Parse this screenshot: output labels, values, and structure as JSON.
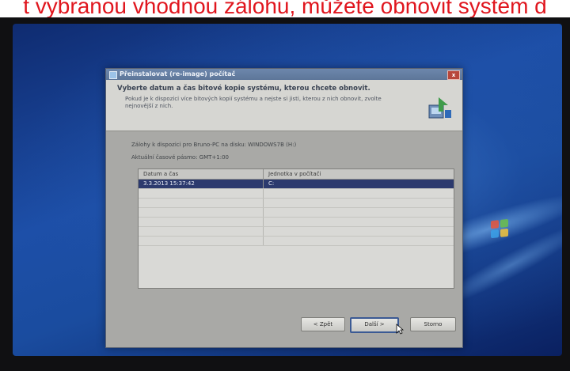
{
  "caption": {
    "text": "t vybranou vhodnou zálohu, můžete obnovit systém d",
    "color": "#e0161e"
  },
  "dialog": {
    "title": "Přeinstalovat (re-image) počítač",
    "close_label": "x",
    "header_title": "Vyberte datum a čas bitové kopie systému, kterou chcete obnovit.",
    "header_description": "Pokud je k dispozici více bitových kopií systému a nejste si jisti, kterou z nich obnovit, zvolte nejnovější z nich.",
    "header_icon": "backup-restore-icon",
    "backup_info": "Zálohy k dispozici pro Bruno-PC na disku: WINDOWS7B (H:)",
    "timezone_info": "Aktuální časové pásmo: GMT+1:00",
    "table": {
      "columns": [
        "Datum a čas",
        "Jednotka v počítači"
      ],
      "rows": [
        {
          "date": "3.3.2013 15:37:42",
          "drive": "C:",
          "selected": true
        }
      ],
      "empty_rows": 6
    },
    "buttons": {
      "back": "< Zpět",
      "next": "Další >",
      "cancel": "Storno"
    }
  },
  "desktop": {
    "logo_icon": "windows-logo-icon",
    "accent": "#1d4fa8"
  }
}
